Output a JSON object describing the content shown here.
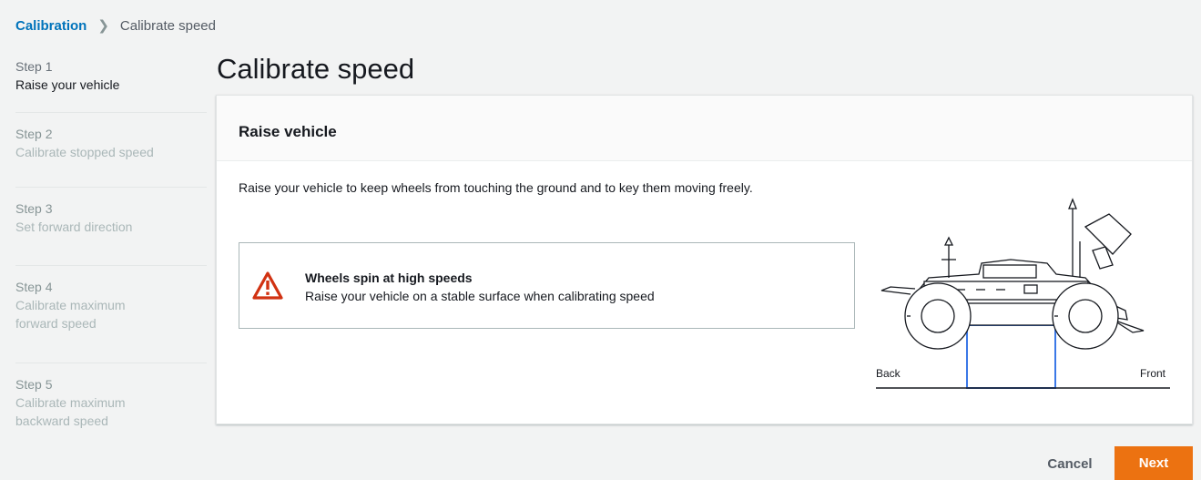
{
  "breadcrumb": {
    "parent": "Calibration",
    "current": "Calibrate speed"
  },
  "steps": [
    {
      "number": "Step 1",
      "label": "Raise your vehicle",
      "active": true
    },
    {
      "number": "Step 2",
      "label": "Calibrate stopped speed",
      "active": false
    },
    {
      "number": "Step 3",
      "label": "Set forward direction",
      "active": false
    },
    {
      "number": "Step 4",
      "label": "Calibrate maximum forward speed",
      "active": false
    },
    {
      "number": "Step 5",
      "label": "Calibrate maximum backward speed",
      "active": false
    }
  ],
  "page": {
    "title": "Calibrate speed"
  },
  "panel": {
    "title": "Raise vehicle",
    "description": "Raise your vehicle to keep wheels from touching the ground and to key them moving freely.",
    "alert": {
      "icon": "warning-icon",
      "title": "Wheels spin at high speeds",
      "body": "Raise your vehicle on a stable surface when calibrating speed"
    },
    "illustration": {
      "back_label": "Back",
      "front_label": "Front"
    }
  },
  "actions": {
    "cancel": "Cancel",
    "next": "Next"
  },
  "colors": {
    "link": "#0073bb",
    "primary": "#ec7211",
    "warning": "#d13212",
    "support": "#3b78e7"
  }
}
